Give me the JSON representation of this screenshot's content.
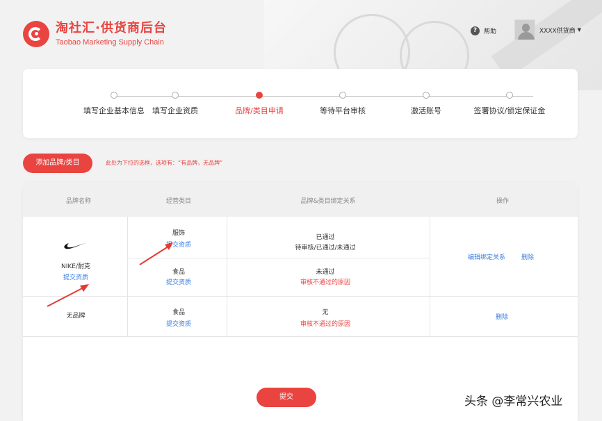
{
  "header": {
    "logo_title": "淘社汇·供货商后台",
    "logo_subtitle": "Taobao Marketing Supply Chain",
    "help_label": "帮助",
    "user_name": "XXXX供货商"
  },
  "steps": [
    {
      "label": "填写企业基本信息",
      "active": false
    },
    {
      "label": "填写企业资质",
      "active": false
    },
    {
      "label": "品牌/类目申请",
      "active": true
    },
    {
      "label": "等待平台审核",
      "active": false
    },
    {
      "label": "激活账号",
      "active": false
    },
    {
      "label": "签署协议/锁定保证金",
      "active": false
    }
  ],
  "toolbar": {
    "add_label": "添加品牌/类目",
    "note": "此处为下拉的选框，选项有：“有品牌，无品牌”"
  },
  "table": {
    "headers": [
      "品牌名称",
      "经营类目",
      "品牌&类目绑定关系",
      "操作"
    ],
    "rows": [
      {
        "brand": "NIKE/耐克",
        "brand_link": "提交资质",
        "categories": [
          {
            "name": "服饰",
            "link": "提交资质",
            "status": "已通过",
            "status_detail": "待审核/已通过/未通过"
          },
          {
            "name": "食品",
            "link": "提交资质",
            "status": "未通过",
            "status_detail": "审核不通过的原因"
          }
        ],
        "actions": [
          "编辑绑定关系",
          "删除"
        ]
      },
      {
        "brand": "无品牌",
        "categories": [
          {
            "name": "食品",
            "link": "提交资质",
            "status": "无",
            "status_detail": "审核不通过的原因"
          }
        ],
        "actions": [
          "删除"
        ]
      }
    ]
  },
  "submit_label": "提交",
  "watermark": "头条 @李常兴农业",
  "colors": {
    "accent": "#e94440",
    "link": "#3a7ce0"
  },
  "icons": [
    "help-icon",
    "avatar-icon",
    "nike-swoosh-icon"
  ]
}
